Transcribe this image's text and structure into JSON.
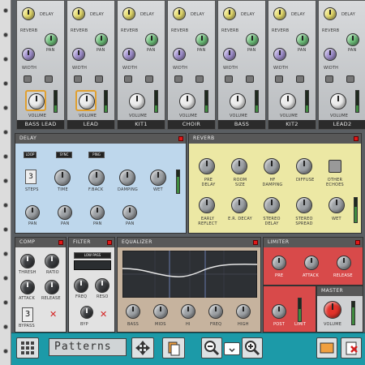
{
  "strips": [
    {
      "name": "BASS LEAD",
      "k1": "DELAY",
      "k2": "REVERB",
      "k3": "PAN",
      "k4": "WIDTH",
      "vol": "VOLUME",
      "c1": "k-yel",
      "c2": "k-blu",
      "c3": "k-grn",
      "c4": "k-pur",
      "orange": true
    },
    {
      "name": "LEAD",
      "k1": "DELAY",
      "k2": "REVERB",
      "k3": "PAN",
      "k4": "WIDTH",
      "vol": "VOLUME",
      "c1": "k-yel",
      "c2": "k-blu",
      "c3": "k-grn",
      "c4": "k-pur",
      "orange": true
    },
    {
      "name": "KIT1",
      "k1": "DELAY",
      "k2": "REVERB",
      "k3": "PAN",
      "k4": "WIDTH",
      "vol": "VOLUME",
      "c1": "k-yel",
      "c2": "k-blu",
      "c3": "k-grn",
      "c4": "k-pur",
      "orange": false
    },
    {
      "name": "CHOIR",
      "k1": "DELAY",
      "k2": "REVERB",
      "k3": "PAN",
      "k4": "WIDTH",
      "vol": "VOLUME",
      "c1": "k-yel",
      "c2": "k-blu",
      "c3": "k-grn",
      "c4": "k-pur",
      "orange": false
    },
    {
      "name": "BASS",
      "k1": "DELAY",
      "k2": "REVERB",
      "k3": "PAN",
      "k4": "WIDTH",
      "vol": "VOLUME",
      "c1": "k-yel",
      "c2": "k-blu",
      "c3": "k-grn",
      "c4": "k-pur",
      "orange": false
    },
    {
      "name": "KIT2",
      "k1": "DELAY",
      "k2": "REVERB",
      "k3": "PAN",
      "k4": "WIDTH",
      "vol": "VOLUME",
      "c1": "k-yel",
      "c2": "k-blu",
      "c3": "k-grn",
      "c4": "k-pur",
      "orange": false
    },
    {
      "name": "LEAD2",
      "k1": "DELAY",
      "k2": "REVERB",
      "k3": "PAN",
      "k4": "WIDTH",
      "vol": "VOLUME",
      "c1": "k-yel",
      "c2": "k-blu",
      "c3": "k-grn",
      "c4": "k-pur",
      "orange": false
    }
  ],
  "delay": {
    "title": "DELAY",
    "steps": "STEPS",
    "time": "TIME",
    "fback": "F.BACK",
    "damping": "DAMPING",
    "wet": "WET",
    "pan": "PAN",
    "step_value": "3",
    "sw1": "LOOP",
    "sw2": "SYNC",
    "sw3": "PING"
  },
  "reverb": {
    "title": "REVERB",
    "predelay": "PRE DELAY",
    "roomsize": "ROOM SIZE",
    "hfdamping": "HF DAMPING",
    "diffuse": "DIFFUSE",
    "other": "OTHER ECHOES",
    "early": "EARLY REFLECT",
    "erdecay": "E.R. DECAY",
    "stereodelay": "STEREO DELAY",
    "stereospread": "STEREO SPREAD",
    "wet": "WET"
  },
  "comp": {
    "title": "COMP",
    "thresh": "THRESH",
    "ratio": "RATIO",
    "attack": "ATTACK",
    "release": "RELEASE",
    "bypass": "BYPASS",
    "bypass_value": "3"
  },
  "filter": {
    "title": "FILTER",
    "mode": "LOW PASS",
    "freq": "FREQ",
    "reso": "RESO",
    "bypass": "BYP"
  },
  "equalizer": {
    "title": "EQUALIZER",
    "bass": "BASS",
    "mids": "MIDS",
    "hi": "HI",
    "freq": "FREQ",
    "high": "HIGH"
  },
  "limiter": {
    "title": "LIMITER",
    "pre": "PRE",
    "attack": "ATTACK",
    "release": "RELEASE",
    "post": "POST",
    "limit": "LIMIT"
  },
  "master": {
    "title": "MASTER",
    "volume": "VOLUME"
  },
  "toolbar": {
    "patterns": "Patterns"
  }
}
